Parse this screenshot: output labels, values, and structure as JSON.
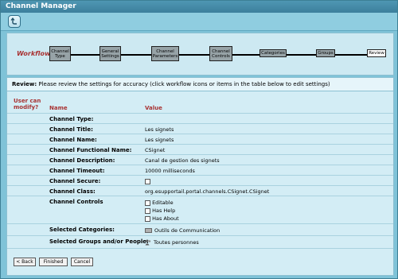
{
  "window": {
    "title": "Channel Manager"
  },
  "workflow": {
    "label": "Workflow:",
    "steps": [
      {
        "label": "Channel Type"
      },
      {
        "label": "General Settings"
      },
      {
        "label": "Channel Parameters"
      },
      {
        "label": "Channel Controls"
      },
      {
        "label": "Categories"
      },
      {
        "label": "Groups"
      },
      {
        "label": "Review"
      }
    ]
  },
  "review": {
    "heading": "Review:",
    "instruction": "Please review the settings for accuracy (click workflow icons or items in the table below to edit settings)"
  },
  "table": {
    "col_modify": "User can modify?",
    "col_name": "Name",
    "col_value": "Value",
    "rows": [
      {
        "name": "Channel Type:",
        "value": ""
      },
      {
        "name": "Channel Title:",
        "value": "Les signets"
      },
      {
        "name": "Channel Name:",
        "value": "Les signets"
      },
      {
        "name": "Channel Functional Name:",
        "value": "CSignet"
      },
      {
        "name": "Channel Description:",
        "value": "Canal de gestion des signets"
      },
      {
        "name": "Channel Timeout:",
        "value": "10000 milliseconds"
      },
      {
        "name": "Channel Secure:",
        "value": ""
      },
      {
        "name": "Channel Class:",
        "value": "org.esupportail.portal.channels.CSignet.CSignet"
      },
      {
        "name": "Channel Controls",
        "value": ""
      },
      {
        "name": "Selected Categories:",
        "value": "Outils de Communication"
      },
      {
        "name": "Selected Groups and/or People:",
        "value": "Toutes personnes"
      }
    ],
    "controls": [
      "Editable",
      "Has Help",
      "Has About"
    ]
  },
  "buttons": {
    "back": "< Back",
    "finished": "Finished",
    "cancel": "Cancel"
  },
  "colors": {
    "frame": "#7fc3d8",
    "accent": "#a83232",
    "step": "#97a3a7"
  }
}
